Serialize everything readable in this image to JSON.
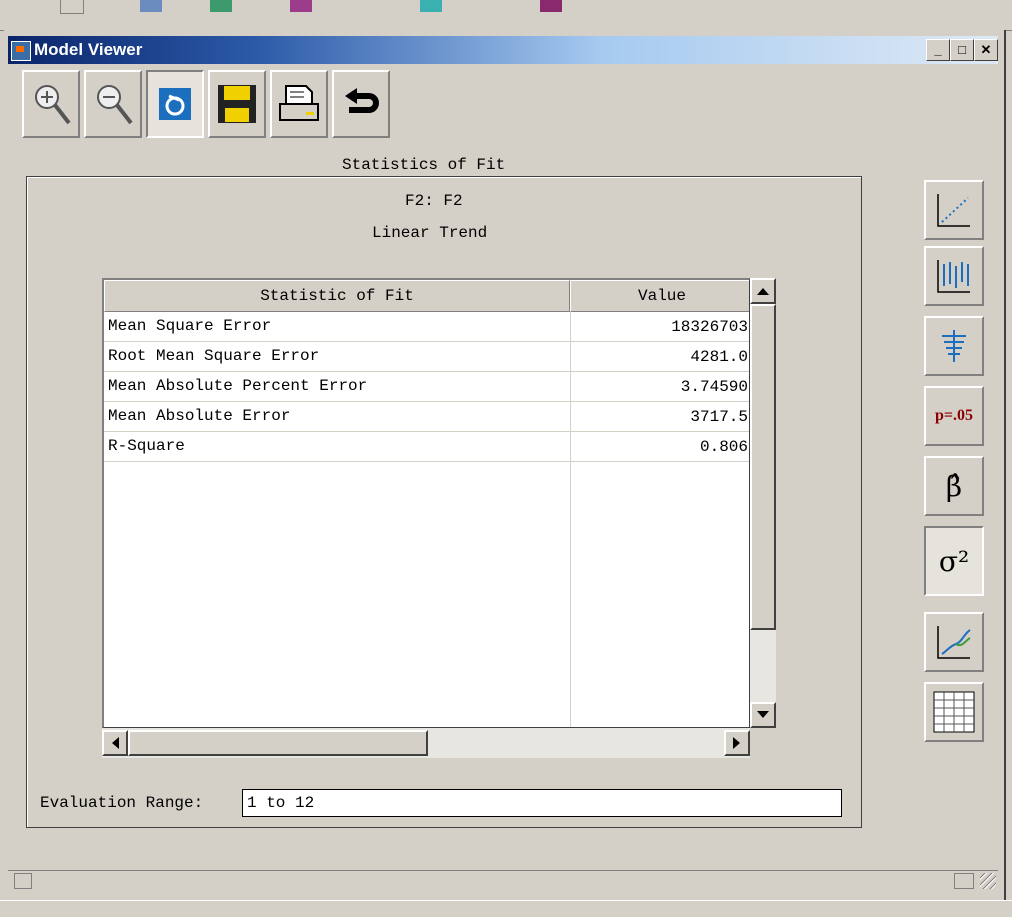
{
  "window": {
    "title": "Model Viewer"
  },
  "toolbar": {
    "buttons": [
      {
        "name": "zoom-in"
      },
      {
        "name": "zoom-out"
      },
      {
        "name": "link"
      },
      {
        "name": "save"
      },
      {
        "name": "print"
      },
      {
        "name": "undo"
      }
    ]
  },
  "panel": {
    "group_title": "Statistics of Fit",
    "series_label": "F2: F2",
    "model_label": "Linear Trend"
  },
  "table": {
    "columns": [
      "Statistic of Fit",
      "Value"
    ],
    "rows": [
      {
        "stat": "Mean Square Error",
        "value": "18326703"
      },
      {
        "stat": "Root Mean Square Error",
        "value": "4281.0"
      },
      {
        "stat": "Mean Absolute Percent Error",
        "value": "3.74590"
      },
      {
        "stat": "Mean Absolute Error",
        "value": "3717.5"
      },
      {
        "stat": "R-Square",
        "value": "0.806"
      }
    ]
  },
  "evaluation": {
    "label": "Evaluation Range:",
    "value": "1 to 12"
  },
  "side_buttons": [
    {
      "name": "scatter-plot-icon"
    },
    {
      "name": "error-bars-icon"
    },
    {
      "name": "residuals-icon"
    },
    {
      "name": "p-value-icon",
      "text": "p=.05"
    },
    {
      "name": "beta-hat-icon",
      "text": "β̂"
    },
    {
      "name": "sigma-squared-icon",
      "text": "σ²"
    },
    {
      "name": "forecast-graph-icon"
    },
    {
      "name": "table-grid-icon"
    }
  ]
}
